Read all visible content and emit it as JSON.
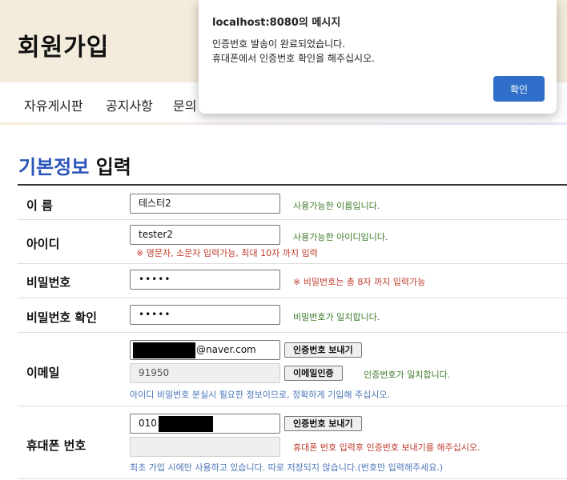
{
  "header": {
    "title": "회원가입"
  },
  "nav": {
    "items": [
      "자유게시판",
      "공지사항",
      "문의"
    ]
  },
  "section": {
    "title_highlight": "기본정보",
    "title_rest": "입력"
  },
  "form": {
    "name": {
      "label": "이 름",
      "value": "테스터2",
      "message": "사용가능한 이름입니다."
    },
    "userid": {
      "label": "아이디",
      "value": "tester2",
      "message": "사용가능한 아이디입니다.",
      "hint": "※ 영문자, 소문자 입력가능, 최대 10자 까지 입력"
    },
    "password": {
      "label": "비밀번호",
      "value": "•••••",
      "message": "※ 비밀번호는 총 8자 까지 입력가능"
    },
    "password_confirm": {
      "label": "비밀번호 확인",
      "value": "•••••",
      "message": "비밀번호가 일치합니다."
    },
    "email": {
      "label": "이메일",
      "value_suffix": "@naver.com",
      "send_button": "인증번호 보내기",
      "code_value": "91950",
      "verify_button": "이메일인증",
      "code_message": "인증번호가 일치합니다.",
      "note": "아이디 비밀번호 분실시 필요한 정보이므로, 정확하게 기입해 주십시오."
    },
    "phone": {
      "label": "휴대폰 번호",
      "value_prefix": "010",
      "send_button": "인증번호 보내기",
      "code_message": "휴대폰 번호 입력후 인증번호 보내기를 해주십시오.",
      "note": "최초 가입 시에만 사용하고 있습니다. 따로 저장되지 않습니다.(번호만 입력해주세요.)"
    }
  },
  "dialog": {
    "title": "localhost:8080의 메시지",
    "line1": "인증번호 발송이 완료되었습니다.",
    "line2": "휴대폰에서 인증번호 확인을 해주십시오.",
    "ok_label": "확인"
  },
  "colors": {
    "accent": "#2b54b8",
    "success": "#3c7a2a",
    "error": "#c0392b",
    "hero_bg": "#f3ecdc",
    "dialog_button": "#2f6fc9"
  }
}
